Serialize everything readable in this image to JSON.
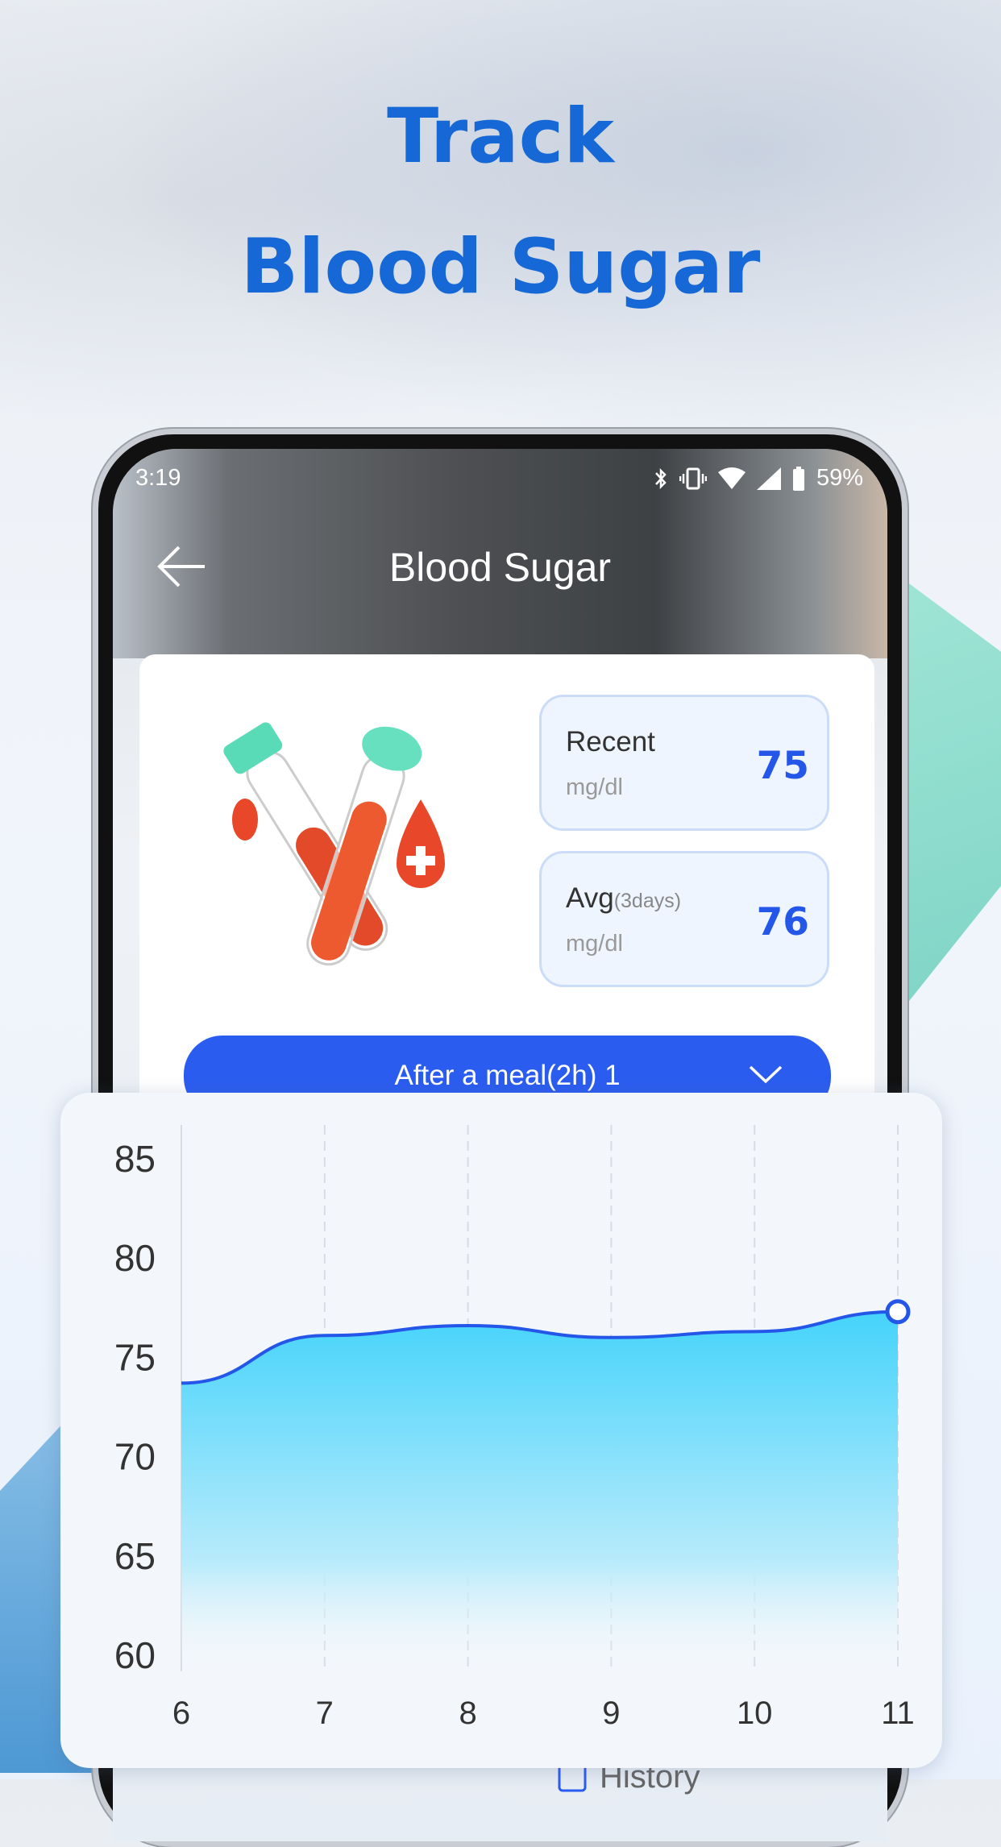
{
  "headline": {
    "line1": "Track",
    "line2": "Blood Sugar"
  },
  "status_bar": {
    "time": "3:19",
    "battery": "59%",
    "icons": [
      "bluetooth-icon",
      "vibrate-icon",
      "wifi-icon",
      "signal-icon",
      "battery-icon"
    ]
  },
  "header": {
    "title": "Blood Sugar",
    "back_icon": "arrow-left-icon"
  },
  "stats": {
    "recent": {
      "label": "Recent",
      "unit": "mg/dl",
      "value": "75"
    },
    "avg": {
      "label": "Avg",
      "qualifier": "(3days)",
      "unit": "mg/dl",
      "value": "76"
    }
  },
  "dropdown": {
    "selected": "After a meal(2h) 1",
    "icon": "chevron-down-icon"
  },
  "history": {
    "label": "History"
  },
  "colors": {
    "accent": "#2b5cf0",
    "value": "#2456e8",
    "headline": "#1668d6",
    "area": "#4fd4fb"
  },
  "chart_data": {
    "type": "area",
    "x": [
      6,
      7,
      8,
      9,
      10,
      11
    ],
    "values": [
      73.7,
      76.1,
      76.6,
      76.0,
      76.3,
      77.3
    ],
    "ylim": [
      60,
      85
    ],
    "yticks": [
      85,
      80,
      75,
      70,
      65,
      60
    ],
    "xticks": [
      "6",
      "7",
      "8",
      "9",
      "10",
      "11"
    ],
    "grid": "vertical dashed",
    "highlighted_point": 11
  }
}
